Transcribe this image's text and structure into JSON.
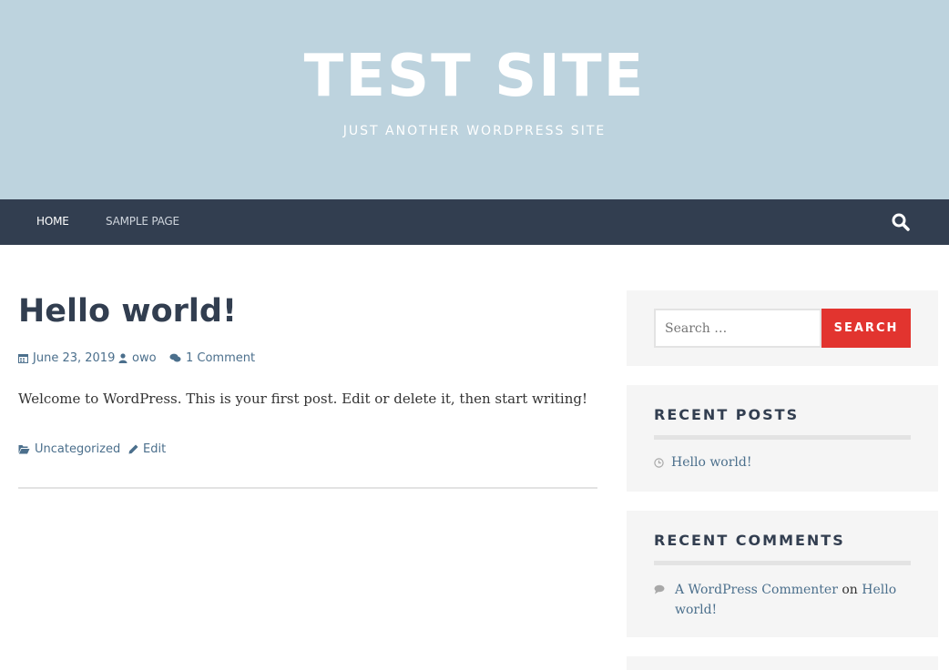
{
  "header": {
    "site_title": "TEST SITE",
    "site_description": "JUST ANOTHER WORDPRESS SITE"
  },
  "nav": {
    "items": [
      {
        "label": "HOME"
      },
      {
        "label": "SAMPLE PAGE"
      }
    ],
    "search_icon": "search-icon"
  },
  "post": {
    "title": "Hello world!",
    "date": "June 23, 2019",
    "author": "owo",
    "comments": "1 Comment",
    "body": "Welcome to WordPress. This is your first post. Edit or delete it, then start writing!",
    "category": "Uncategorized",
    "edit_label": "Edit"
  },
  "sidebar": {
    "search": {
      "placeholder": "Search …",
      "button_label": "SEARCH"
    },
    "recent_posts": {
      "title": "RECENT POSTS",
      "items": [
        {
          "label": "Hello world!"
        }
      ]
    },
    "recent_comments": {
      "title": "RECENT COMMENTS",
      "items": [
        {
          "author": "A WordPress Commenter",
          "joiner": "on",
          "post": "Hello world!"
        }
      ]
    }
  },
  "colors": {
    "header_bg": "#bdd3de",
    "nav_bg": "#323e50",
    "accent": "#e2342f",
    "link": "#4b6f8c"
  }
}
